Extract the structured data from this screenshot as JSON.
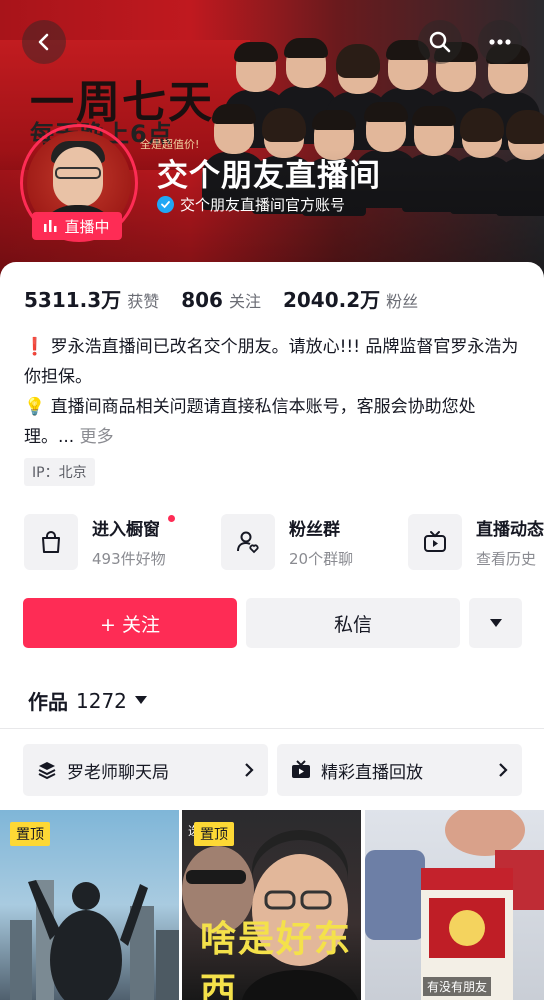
{
  "banner": {
    "promo_line1": "一周七天",
    "promo_line2": "每天晚上6点",
    "promo_line3": "全是超值价!"
  },
  "profile": {
    "name": "交个朋友直播间",
    "verified_label": "交个朋友直播间官方账号",
    "live_badge": "直播中",
    "ip": "IP：北京"
  },
  "stats": [
    {
      "value": "5311.3万",
      "label": "获赞"
    },
    {
      "value": "806",
      "label": "关注"
    },
    {
      "value": "2040.2万",
      "label": "粉丝"
    }
  ],
  "bio": {
    "line1": "❗ 罗永浩直播间已改名交个朋友。请放心!!! 品牌监督官罗永浩为你担保。",
    "line2": "💡 直播间商品相关问题请直接私信本账号，客服会协助您处理。...",
    "more": "更多"
  },
  "shortcuts": [
    {
      "title": "进入橱窗",
      "sub": "493件好物",
      "icon": "shopping-bag-icon"
    },
    {
      "title": "粉丝群",
      "sub": "20个群聊",
      "icon": "fan-group-icon"
    },
    {
      "title": "直播动态",
      "sub": "查看历史",
      "icon": "tv-icon"
    }
  ],
  "actions": {
    "follow": "+ 关注",
    "message": "私信"
  },
  "works": {
    "label": "作品",
    "count": "1272"
  },
  "collections": [
    {
      "label": "罗老师聊天局",
      "icon": "layers-icon"
    },
    {
      "label": "精彩直播回放",
      "icon": "live-replay-icon"
    }
  ],
  "tiles": [
    {
      "pin": "置顶"
    },
    {
      "pin": "置顶",
      "select": "选",
      "big": "啥是好东西"
    },
    {
      "caption": "有没有朋友"
    }
  ],
  "colors": {
    "accent": "#fe2c55",
    "verify": "#20a7f5",
    "pin": "#fdd835"
  }
}
